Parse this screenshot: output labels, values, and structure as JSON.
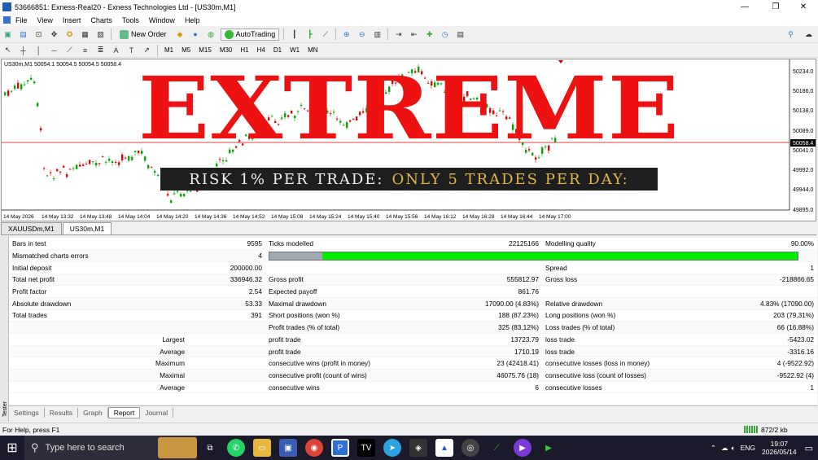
{
  "window": {
    "title": "53666851: Exness-Real20 - Exness Technologies Ltd - [US30m,M1]",
    "controls": {
      "min": "—",
      "max": "❐",
      "close": "✕"
    }
  },
  "menu": [
    "File",
    "View",
    "Insert",
    "Charts",
    "Tools",
    "Window",
    "Help"
  ],
  "toolbar": {
    "new_order": "New Order",
    "autotrading": "AutoTrading",
    "timeframes": [
      "M1",
      "M5",
      "M15",
      "M30",
      "H1",
      "H4",
      "D1",
      "W1",
      "MN"
    ]
  },
  "chart": {
    "info": "US30m,M1  50054.1 50054.5 50054.5 50058.4",
    "price_labels": [
      "50234.0",
      "50186.0",
      "50138.0",
      "50089.0",
      "50058.4",
      "50041.0",
      "49992.0",
      "49944.0",
      "49895.0"
    ],
    "time_labels": [
      "14 May 2026",
      "14 May 13:32",
      "14 May 13:48",
      "14 May 14:04",
      "14 May 14:20",
      "14 May 14:36",
      "14 May 14:52",
      "14 May 15:08",
      "14 May 15:24",
      "14 May 15:40",
      "14 May 15:56",
      "14 May 16:12",
      "14 May 16:28",
      "14 May 16:44",
      "14 May 17:00"
    ],
    "current_price": "50058.4",
    "colors": {
      "bull": "#00aa00",
      "bear": "#ee0000",
      "price_line": "#cc0000"
    }
  },
  "chart_tabs": [
    "XAUUSDm,M1",
    "US30m,M1"
  ],
  "overlay": {
    "title": "EXTREME",
    "banner_white": "RISK 1% PER TRADE:",
    "banner_yellow": "ONLY 5 TRADES PER DAY:",
    "title_color": "#ee1111",
    "banner_accent": "#e3b64a"
  },
  "report": {
    "rows": [
      [
        "Bars in test",
        "9595",
        "Ticks modelled",
        "22125166",
        "Modelling quality",
        "90.00%"
      ],
      [
        "Mismatched charts errors",
        "4",
        "",
        "",
        "",
        ""
      ],
      [
        "Initial deposit",
        "200000.00",
        "",
        "",
        "Spread",
        "1"
      ],
      [
        "Total net profit",
        "336946.32",
        "Gross profit",
        "555812.97",
        "Gross loss",
        "-218866.65"
      ],
      [
        "Profit factor",
        "2.54",
        "Expected payoff",
        "861.76",
        "",
        ""
      ],
      [
        "Absolute drawdown",
        "53.33",
        "Maximal drawdown",
        "17090.00 (4.83%)",
        "Relative drawdown",
        "4.83% (17090.00)"
      ],
      [
        "Total trades",
        "391",
        "Short positions (won %)",
        "188 (87.23%)",
        "Long positions (won %)",
        "203 (79.31%)"
      ],
      [
        "",
        "",
        "Profit trades (% of total)",
        "325 (83.12%)",
        "Loss trades (% of total)",
        "66 (16.88%)"
      ],
      [
        "Largest",
        "",
        "profit trade",
        "13723.79",
        "loss trade",
        "-5423.02"
      ],
      [
        "Average",
        "",
        "profit trade",
        "1710.19",
        "loss trade",
        "-3316.16"
      ],
      [
        "Maximum",
        "",
        "consecutive wins (profit in money)",
        "23 (42418.41)",
        "consecutive losses (loss in money)",
        "4 (-9522.92)"
      ],
      [
        "Maximal",
        "",
        "consecutive profit (count of wins)",
        "46075.76 (18)",
        "consecutive loss (count of losses)",
        "-9522.92 (4)"
      ],
      [
        "Average",
        "",
        "consecutive wins",
        "6",
        "consecutive losses",
        "1"
      ]
    ],
    "modelling_quality_fraction": 0.9
  },
  "tester_label": "Tester",
  "bottom_tabs": [
    "Settings",
    "Results",
    "Graph",
    "Report",
    "Journal"
  ],
  "status": {
    "help": "For Help, press F1",
    "traffic": "872/2 kb"
  },
  "taskbar": {
    "search_placeholder": "Type here to search",
    "lang": "ENG",
    "time": "19:07",
    "date": "2026/05/14"
  }
}
